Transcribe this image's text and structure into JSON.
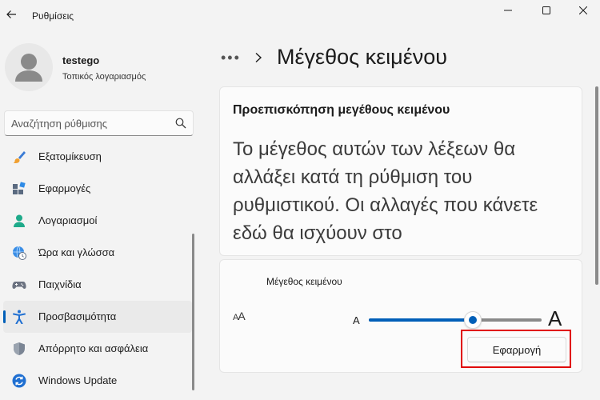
{
  "window": {
    "title": "Ρυθμίσεις"
  },
  "user": {
    "name": "testego",
    "account_type": "Τοπικός λογαριασμός"
  },
  "search": {
    "placeholder": "Αναζήτηση ρύθμισης"
  },
  "sidebar": {
    "items": [
      {
        "label": "Εξατομίκευση",
        "icon": "paintbrush-icon"
      },
      {
        "label": "Εφαρμογές",
        "icon": "apps-icon"
      },
      {
        "label": "Λογαριασμοί",
        "icon": "person-icon"
      },
      {
        "label": "Ώρα και γλώσσα",
        "icon": "globe-clock-icon"
      },
      {
        "label": "Παιχνίδια",
        "icon": "gamepad-icon"
      },
      {
        "label": "Προσβασιμότητα",
        "icon": "accessibility-icon",
        "active": true
      },
      {
        "label": "Απόρρητο και ασφάλεια",
        "icon": "shield-icon"
      },
      {
        "label": "Windows Update",
        "icon": "update-icon"
      }
    ]
  },
  "breadcrumb": {
    "more": "•••",
    "current": "Μέγεθος κειμένου"
  },
  "preview": {
    "title": "Προεπισκόπηση μεγέθους κειμένου",
    "text": "Το μέγεθος αυτών των λέξεων θα αλλάξει κατά τη ρύθμιση του ρυθμιστικού. Οι αλλαγές που κάνετε εδώ θα ισχύουν στο"
  },
  "text_size": {
    "label": "Μέγεθος κειμένου",
    "min_label": "A",
    "max_label": "A",
    "value_fraction": 0.6,
    "apply_label": "Εφαρμογή"
  },
  "colors": {
    "accent": "#005fb8",
    "highlight": "#e00000"
  }
}
